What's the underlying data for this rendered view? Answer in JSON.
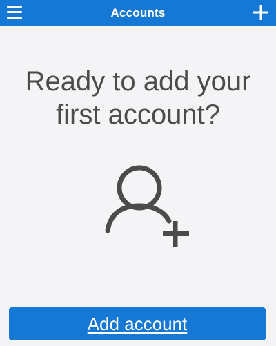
{
  "header": {
    "title": "Accounts",
    "menu_icon": "hamburger-menu-icon",
    "add_icon": "plus-icon"
  },
  "empty_state": {
    "headline_line1": "Ready to add your",
    "headline_line2": "first account?",
    "icon": "user-add-icon"
  },
  "actions": {
    "add_account_label": "Add account"
  },
  "colors": {
    "brand_blue": "#1478d4",
    "background": "#f4f3f5",
    "text_gray": "#4b4b4b"
  }
}
